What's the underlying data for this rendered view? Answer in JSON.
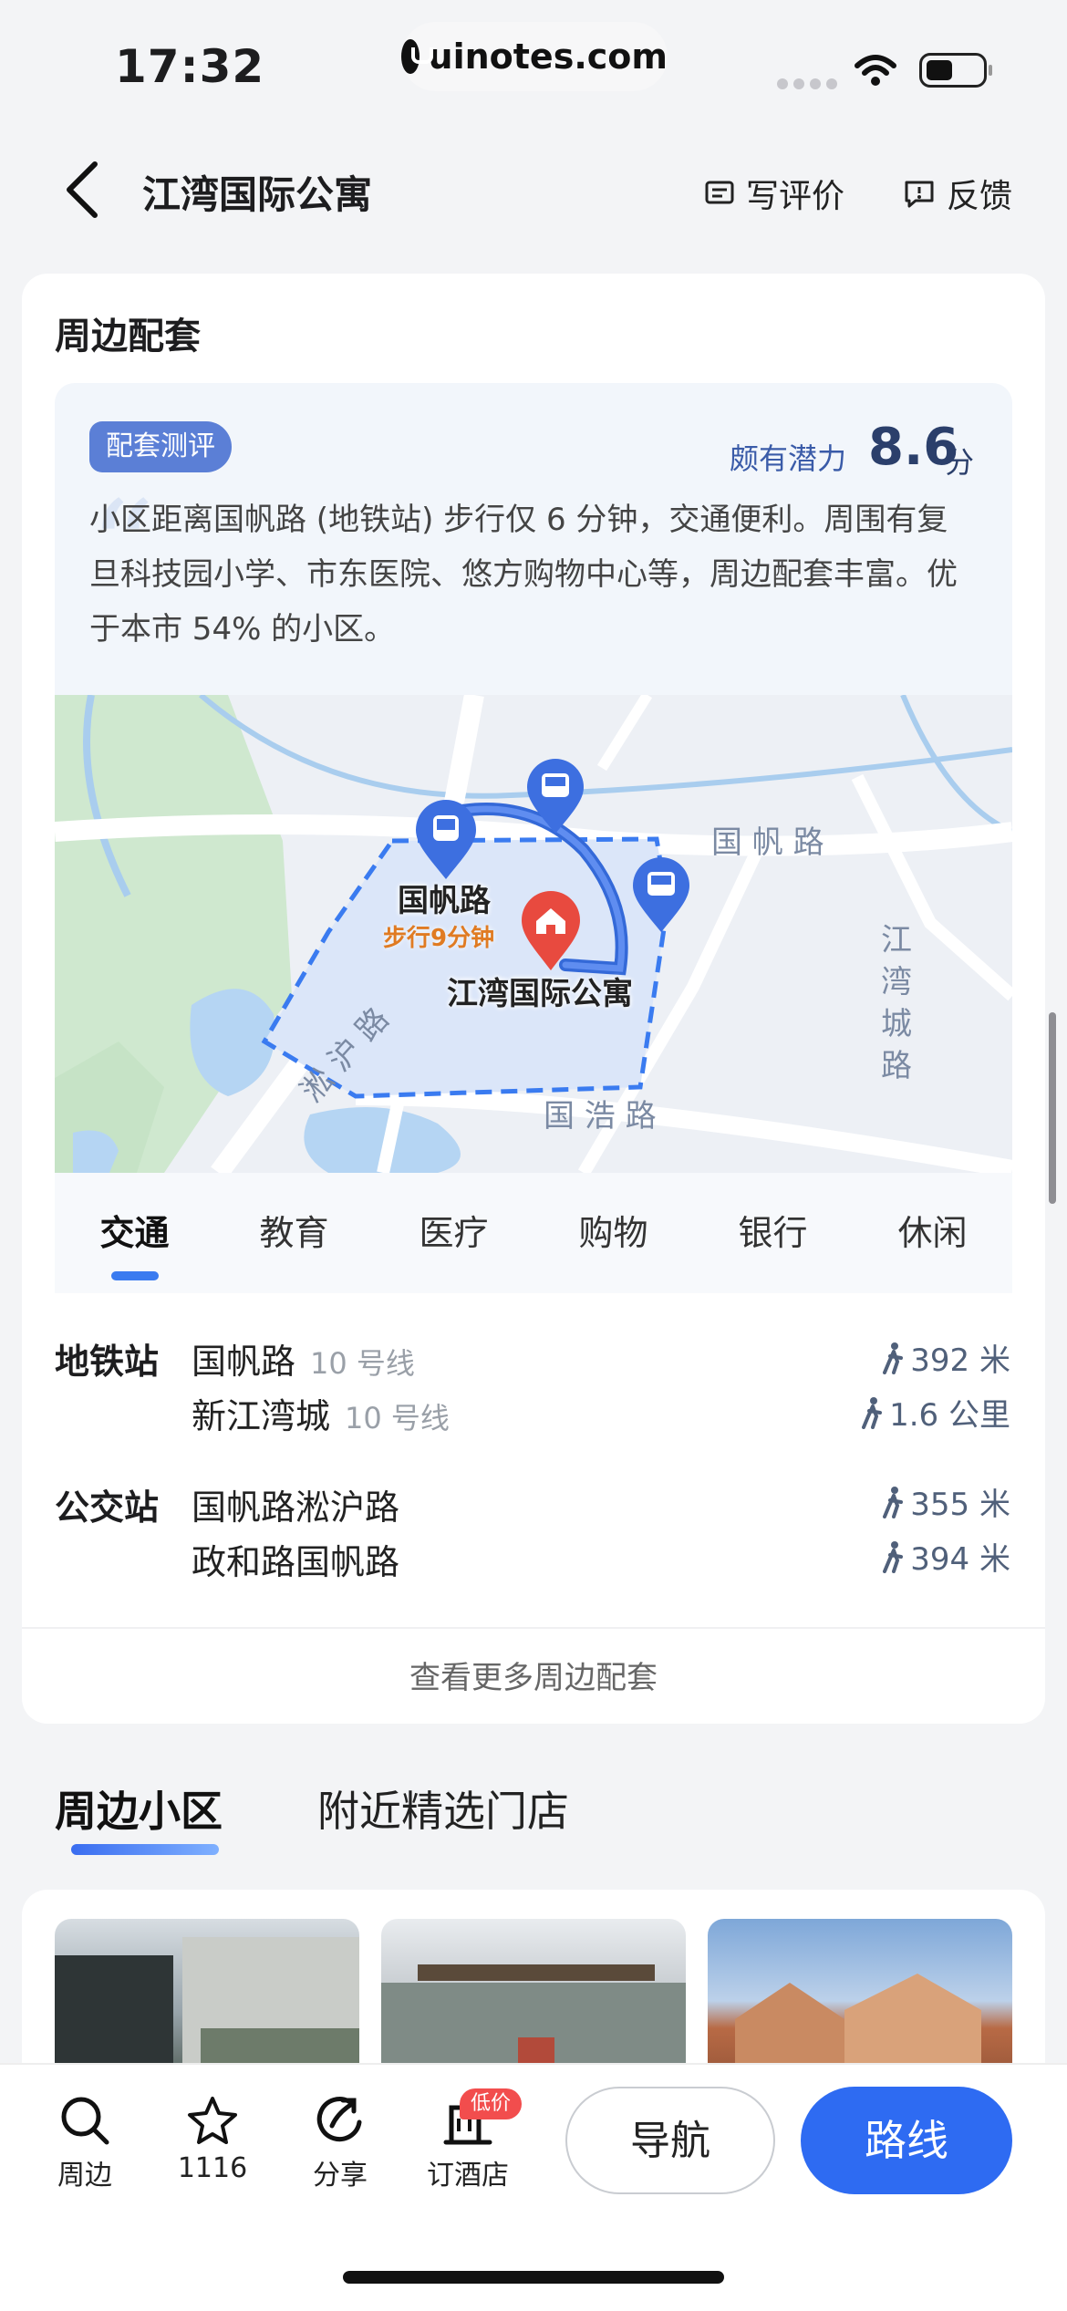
{
  "status": {
    "time": "17:32",
    "url": "uinotes.com"
  },
  "header": {
    "title": "江湾国际公寓",
    "review": "写评价",
    "feedback": "反馈"
  },
  "section": {
    "title": "周边配套",
    "badge": "配套测评",
    "score_label": "颇有潜力",
    "score": "8.6",
    "score_unit": "分",
    "description": "小区距离国帆路 (地铁站) 步行仅 6 分钟，交通便利。周围有复旦科技园小学、市东医院、悠方购物中心等，周边配套丰富。优于本市 54% 的小区。"
  },
  "map": {
    "station": "国帆路",
    "walk": "步行9分钟",
    "place": "江湾国际公寓",
    "road1": "国 帆 路",
    "road2": "淞 沪 路",
    "road3": "国 浩 路",
    "road4": "江 湾 城 路"
  },
  "tabs": [
    "交通",
    "教育",
    "医疗",
    "购物",
    "银行",
    "休闲"
  ],
  "transport": {
    "metro_label": "地铁站",
    "metro": [
      {
        "name": "国帆路",
        "line": "10 号线",
        "dist": "392 米"
      },
      {
        "name": "新江湾城",
        "line": "10 号线",
        "dist": "1.6 公里"
      }
    ],
    "bus_label": "公交站",
    "bus": [
      {
        "name": "国帆路淞沪路",
        "dist": "355 米"
      },
      {
        "name": "政和路国帆路",
        "dist": "394 米"
      }
    ]
  },
  "more": "查看更多周边配套",
  "lower_tabs": {
    "nearby": "周边小区",
    "stores": "附近精选门店"
  },
  "bottom": {
    "nearby": "周边",
    "favorites": "1116",
    "share": "分享",
    "hotel": "订酒店",
    "hotel_badge": "低价",
    "navigate": "导航",
    "route": "路线"
  },
  "colors": {
    "accent": "#2e6bf2",
    "badge": "#5b7fd6",
    "pin_red": "#e84a3f"
  }
}
